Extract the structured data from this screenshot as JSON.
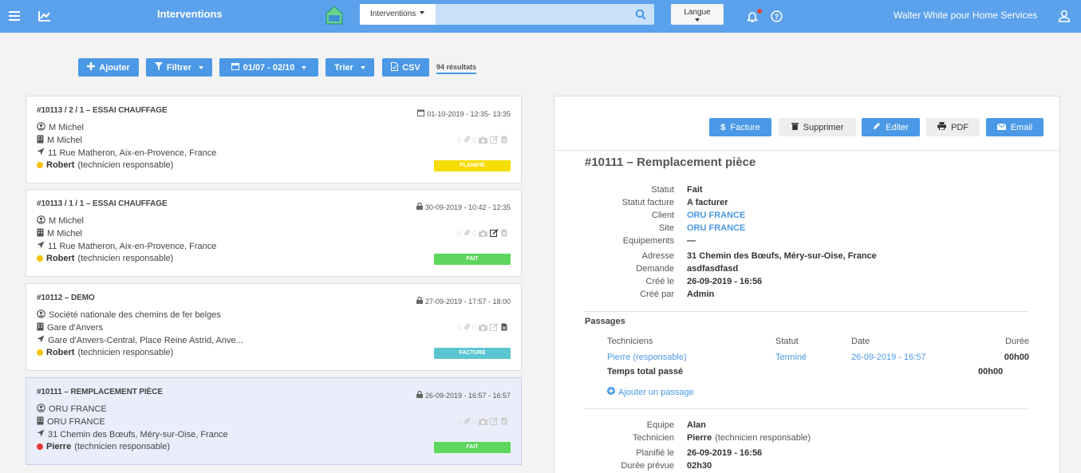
{
  "header": {
    "title": "Interventions",
    "search": {
      "scope": "Interventions",
      "placeholder": ""
    },
    "language_label": "Langue",
    "user": "Walter White pour Home Services"
  },
  "toolbar": {
    "add": "Ajouter",
    "filter": "Filtrer",
    "dates": "01/07 - 02/10",
    "sort": "Trier",
    "csv": "CSV",
    "results": "94 résultats"
  },
  "list": [
    {
      "title": "#10113 / 2 / 1 – ESSAI CHAUFFAGE",
      "date": "01-10-2019 - 12:35- 13:35",
      "client": "M Michel",
      "site": "M Michel",
      "address": "11 Rue Matheron, Aix-en-Provence, France",
      "tech": "Robert",
      "tech_role": "(technicien responsable)",
      "dot_color": "#f5c400",
      "attachments": "0",
      "photos": "0",
      "status": "PLANIFIÉ",
      "status_color": "#f7dc00"
    },
    {
      "title": "#10113 / 1 / 1 – ESSAI CHAUFFAGE",
      "date": "30-09-2019 - 10:42 - 12:35",
      "client": "M Michel",
      "site": "M Michel",
      "address": "11 Rue Matheron, Aix-en-Provence, France",
      "tech": "Robert",
      "tech_role": "(technicien responsable)",
      "dot_color": "#f5c400",
      "attachments": "0",
      "photos": "0",
      "status": "FAIT",
      "status_color": "#5cd65c"
    },
    {
      "title": "#10112 – DEMO",
      "date": "27-09-2019 - 17:57 - 18:00",
      "client": "Société nationale des chemins de fer belges",
      "site": "Gare d'Anvers",
      "address": "Gare d'Anvers-Central, Place Reine Astrid, Anve...",
      "tech": "Robert",
      "tech_role": "(technicien responsable)",
      "dot_color": "#f5c400",
      "attachments": "0",
      "photos": "0",
      "status": "FACTURÉ",
      "status_color": "#5bc6cf"
    },
    {
      "title": "#10111 – REMPLACEMENT PIÈCE",
      "date": "26-09-2019 - 16:57 - 16:57",
      "client": "ORU FRANCE",
      "site": "ORU FRANCE",
      "address": "31 Chemin des Bœufs, Méry-sur-Oise, France",
      "tech": "Pierre",
      "tech_role": "(technicien responsable)",
      "dot_color": "#e53935",
      "attachments": "0",
      "photos": "0",
      "status": "FAIT",
      "status_color": "#5cd65c"
    }
  ],
  "detail": {
    "buttons": {
      "invoice": "Facture",
      "delete": "Supprimer",
      "edit": "Editer",
      "pdf": "PDF",
      "email": "Email"
    },
    "title": "#10111 – Remplacement pièce",
    "fields": [
      {
        "key": "Statut",
        "value": "Fait"
      },
      {
        "key": "Statut facture",
        "value": "A facturer"
      },
      {
        "key": "Client",
        "value": "ORU FRANCE"
      },
      {
        "key": "Site",
        "value": "ORU FRANCE"
      },
      {
        "key": "Equipements",
        "value": "—"
      },
      {
        "key": "Adresse",
        "value": "31 Chemin des Bœufs, Méry-sur-Oise, France"
      },
      {
        "key": "Demande",
        "value": "asdfasdfasd"
      },
      {
        "key": "Créé le",
        "value": "26-09-2019 - 16:56"
      },
      {
        "key": "Créé par",
        "value": "Admin"
      }
    ],
    "passages": {
      "title": "Passages",
      "headers": {
        "tech": "Techniciens",
        "status": "Statut",
        "date": "Date",
        "duration": "Durée"
      },
      "row": {
        "tech": "Pierre (responsable)",
        "status": "Terminé",
        "date": "26-09-2019 - 16:57",
        "duration": "00h00"
      },
      "total_label": "Temps total passé",
      "total_value": "00h00",
      "add": "Ajouter un passage"
    },
    "team": [
      {
        "key": "Equipe",
        "value": "Alan",
        "extra": ""
      },
      {
        "key": "Technicien",
        "value": "Pierre",
        "extra": "(technicien responsable)"
      },
      {
        "key": "Planifié le",
        "value": "26-09-2019 - 16:56",
        "extra": ""
      },
      {
        "key": "Durée prévue",
        "value": "02h30",
        "extra": ""
      }
    ]
  },
  "colors": {
    "primary": "#4a98e6",
    "header": "#5ba1ec",
    "selected_card": "#eaeefb"
  }
}
